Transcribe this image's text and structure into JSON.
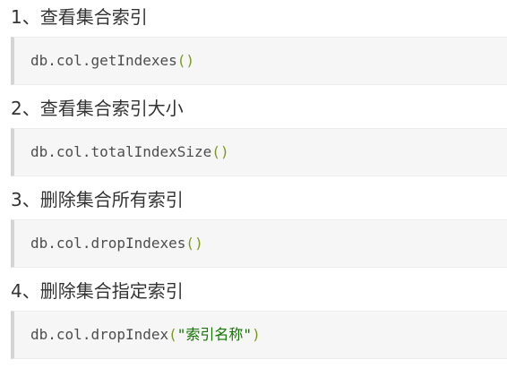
{
  "sections": [
    {
      "heading": "1、查看集合索引",
      "code": {
        "object": "db",
        "dot1": ".",
        "collection": "col",
        "dot2": ".",
        "method": "getIndexes",
        "open": "(",
        "arg": "",
        "close": ")"
      }
    },
    {
      "heading": "2、查看集合索引大小",
      "code": {
        "object": "db",
        "dot1": ".",
        "collection": "col",
        "dot2": ".",
        "method": "totalIndexSize",
        "open": "(",
        "arg": "",
        "close": ")"
      }
    },
    {
      "heading": "3、删除集合所有索引",
      "code": {
        "object": "db",
        "dot1": ".",
        "collection": "col",
        "dot2": ".",
        "method": "dropIndexes",
        "open": "(",
        "arg": "",
        "close": ")"
      }
    },
    {
      "heading": "4、删除集合指定索引",
      "code": {
        "object": "db",
        "dot1": ".",
        "collection": "col",
        "dot2": ".",
        "method": "dropIndex",
        "open": "(",
        "arg": "\"索引名称\"",
        "close": ")"
      }
    }
  ],
  "colors": {
    "heading_text": "#333333",
    "code_text": "#4d4d4d",
    "code_paren": "#7a9a1a",
    "code_string": "#117700",
    "code_background": "#f6f6f6",
    "code_border": "#d5d5d5"
  }
}
